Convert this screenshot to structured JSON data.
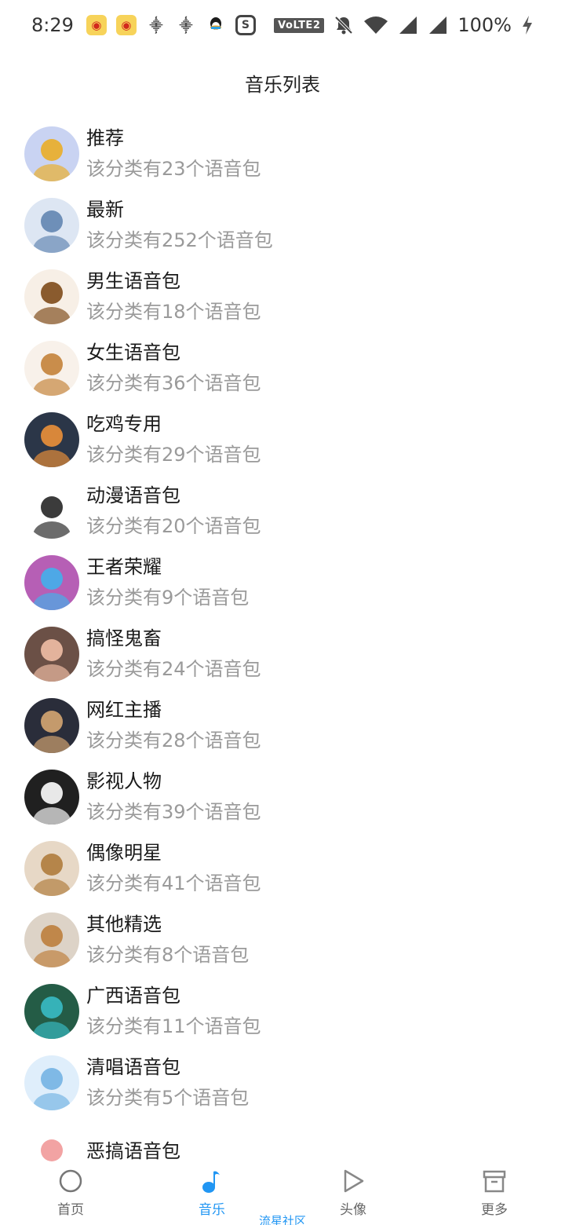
{
  "status_bar": {
    "time": "8:29",
    "volte": "VoLTE2",
    "battery": "100%"
  },
  "title": "音乐列表",
  "items": [
    {
      "name": "推荐",
      "desc": "该分类有23个语音包",
      "avatar_bg": "#c9d3f2",
      "avatar_fg": "#e7b13b"
    },
    {
      "name": "最新",
      "desc": "该分类有252个语音包",
      "avatar_bg": "#dde6f3",
      "avatar_fg": "#6e8fb8"
    },
    {
      "name": "男生语音包",
      "desc": "该分类有18个语音包",
      "avatar_bg": "#f7efe6",
      "avatar_fg": "#8a5b2e"
    },
    {
      "name": "女生语音包",
      "desc": "该分类有36个语音包",
      "avatar_bg": "#f8f1ea",
      "avatar_fg": "#c98d4b"
    },
    {
      "name": "吃鸡专用",
      "desc": "该分类有29个语音包",
      "avatar_bg": "#2b3648",
      "avatar_fg": "#d8873a"
    },
    {
      "name": "动漫语音包",
      "desc": "该分类有20个语音包",
      "avatar_bg": "#ffffff",
      "avatar_fg": "#3b3b3b"
    },
    {
      "name": "王者荣耀",
      "desc": "该分类有9个语音包",
      "avatar_bg": "#b65fb5",
      "avatar_fg": "#4ea8e6"
    },
    {
      "name": "搞怪鬼畜",
      "desc": "该分类有24个语音包",
      "avatar_bg": "#6b5046",
      "avatar_fg": "#e3b39c"
    },
    {
      "name": "网红主播",
      "desc": "该分类有28个语音包",
      "avatar_bg": "#2a2d3a",
      "avatar_fg": "#c49a6c"
    },
    {
      "name": "影视人物",
      "desc": "该分类有39个语音包",
      "avatar_bg": "#202020",
      "avatar_fg": "#e8e8e8"
    },
    {
      "name": "偶像明星",
      "desc": "该分类有41个语音包",
      "avatar_bg": "#e7d8c6",
      "avatar_fg": "#b5854a"
    },
    {
      "name": "其他精选",
      "desc": "该分类有8个语音包",
      "avatar_bg": "#ddd3c7",
      "avatar_fg": "#c0874a"
    },
    {
      "name": "广西语音包",
      "desc": "该分类有11个语音包",
      "avatar_bg": "#245c46",
      "avatar_fg": "#36b2b8"
    },
    {
      "name": "清唱语音包",
      "desc": "该分类有5个语音包",
      "avatar_bg": "#dfeefb",
      "avatar_fg": "#7fb9e6"
    },
    {
      "name": "恶搞语音包",
      "desc": "",
      "avatar_bg": "#ffffff",
      "avatar_fg": "#f2a3a3"
    }
  ],
  "nav": [
    {
      "label": "首页",
      "icon": "circle-icon",
      "active": false
    },
    {
      "label": "音乐",
      "icon": "music-note-icon",
      "active": true
    },
    {
      "label": "头像",
      "icon": "play-icon",
      "active": false
    },
    {
      "label": "更多",
      "icon": "archive-box-icon",
      "active": false
    }
  ],
  "watermark": "流星社区",
  "accent_color": "#2196f3"
}
